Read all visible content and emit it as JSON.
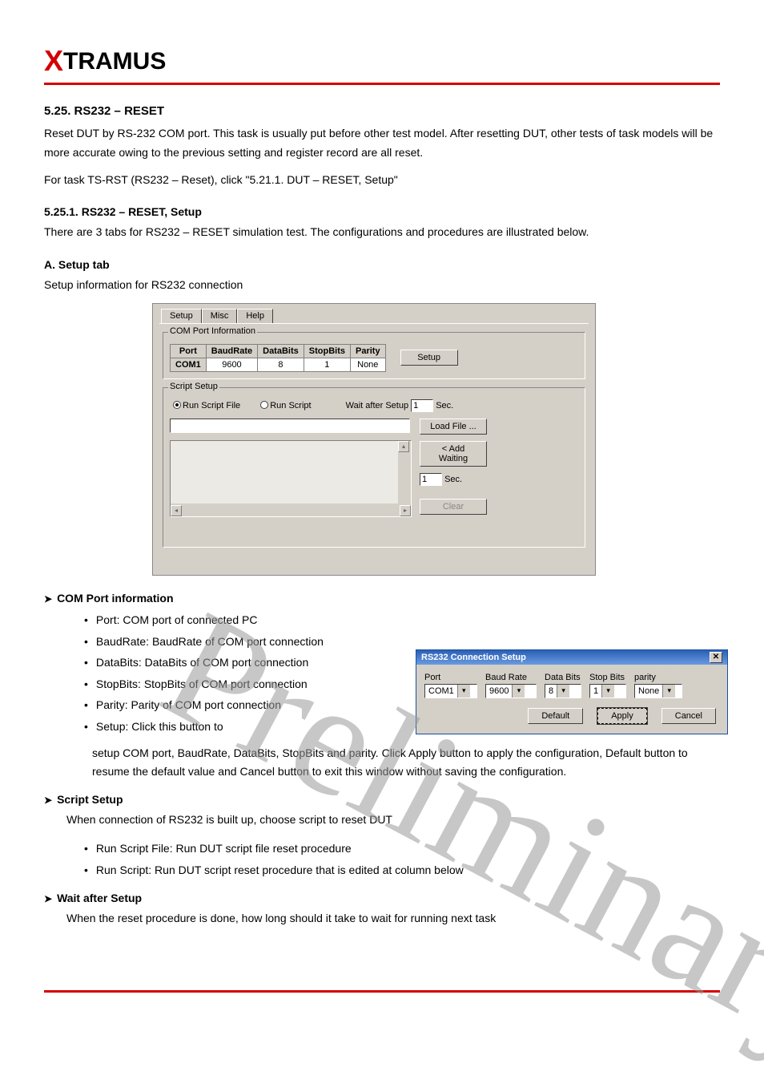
{
  "logo": {
    "prefix": "X",
    "rest": "TRAMUS"
  },
  "sections": {
    "title1": "5.25. RS232 – RESET",
    "intro1": "Reset DUT by RS-232 COM port. This task is usually put before other test model. After resetting DUT, other tests of task models will be more accurate owing to the previous setting and register record are all reset.",
    "intro2": "For task TS-RST (RS232 – Reset), click \"5.21.1. DUT – RESET, Setup\"",
    "sub1": "5.25.1. RS232 – RESET, Setup",
    "sub1text": "There are 3 tabs for RS232 – RESET simulation test. The configurations and procedures are illustrated below.",
    "tabA": "A. Setup tab",
    "tabAtext": "Setup information for RS232 connection"
  },
  "win1": {
    "tabs": [
      "Setup",
      "Misc",
      "Help"
    ],
    "group1": "COM Port Information",
    "th": [
      "Port",
      "BaudRate",
      "DataBits",
      "StopBits",
      "Parity"
    ],
    "row": [
      "COM1",
      "9600",
      "8",
      "1",
      "None"
    ],
    "setupBtn": "Setup",
    "group2": "Script Setup",
    "radio1": "Run Script File",
    "radio2": "Run Script",
    "wait_after": "Wait after Setup",
    "wait_after_val": "1",
    "sec": "Sec.",
    "loadFile": "Load File ...",
    "addWaiting": "< Add Waiting",
    "addWaitingVal": "1",
    "clear": "Clear"
  },
  "com_section": {
    "head": "COM Port information",
    "items": [
      "Port: COM port of connected PC",
      "BaudRate: BaudRate of COM port connection",
      "DataBits: DataBits of COM port connection",
      "StopBits: StopBits of COM port connection",
      "Parity: Parity of COM port connection"
    ],
    "setup_line": "Setup: Click this button to",
    "setup_tail": "setup COM port, BaudRate, DataBits, StopBits and parity. Click Apply button to apply the configuration, Default button to resume the default value and Cancel button to exit this window without saving the configuration."
  },
  "popup": {
    "title": "RS232 Connection Setup",
    "labels": [
      "Port",
      "Baud Rate",
      "Data Bits",
      "Stop Bits",
      "parity"
    ],
    "values": [
      "COM1",
      "9600",
      "8",
      "1",
      "None"
    ],
    "btns": [
      "Default",
      "Apply",
      "Cancel"
    ]
  },
  "script_section": {
    "head": "Script Setup",
    "intro": "When connection of RS232 is built up, choose script to reset DUT",
    "items": [
      "Run Script File: Run DUT script file reset procedure",
      "Run Script: Run DUT script reset procedure that is edited at column below"
    ]
  },
  "wait_section": {
    "head": "Wait after Setup",
    "text": "When the reset procedure is done, how long should it take to wait for running next task"
  },
  "watermark": "Preliminary"
}
